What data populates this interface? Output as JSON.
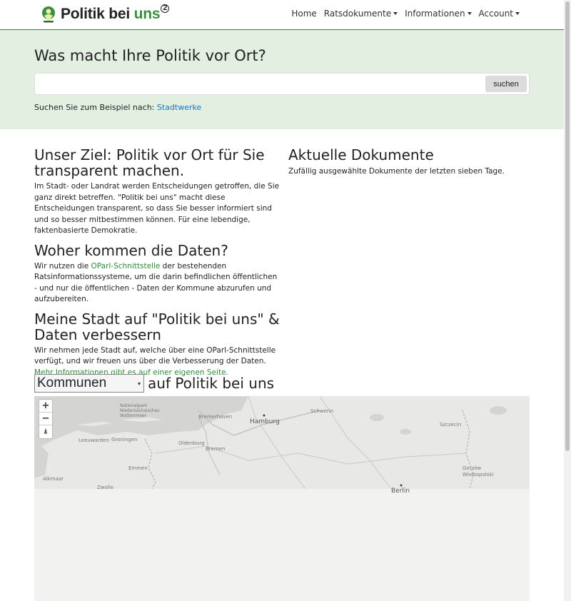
{
  "brand": {
    "name_part1": "Politik bei ",
    "name_part2": "uns",
    "superscript": "2"
  },
  "nav": {
    "items": [
      {
        "label": "Home",
        "dropdown": false
      },
      {
        "label": "Ratsdokumente",
        "dropdown": true
      },
      {
        "label": "Informationen",
        "dropdown": true
      },
      {
        "label": "Account",
        "dropdown": true
      }
    ]
  },
  "hero": {
    "title": "Was macht Ihre Politik vor Ort?",
    "search_value": "",
    "search_button": "suchen",
    "hint_prefix": "Suchen Sie zum Beispiel nach: ",
    "hint_link": "Stadtwerke"
  },
  "left": {
    "goal_title": "Unser Ziel: Politik vor Ort für Sie transparent machen.",
    "goal_text": "Im Stadt- oder Landrat werden Entscheidungen getroffen, die Sie ganz direkt betreffen. \"Politik bei uns\" macht diese Entscheidungen transparent, so dass Sie besser informiert sind und so besser mitbestimmen können. Für eine lebendige, faktenbasierte Demokratie.",
    "data_title": "Woher kommen die Daten?",
    "data_text_prefix": "Wir nutzen die ",
    "data_link": "OParl-Schnittstelle",
    "data_text_suffix": " der bestehenden Ratsinformationssysteme, um die darin befindlichen öffentlichen - und nur die öffentlichen - Daten der Kommune abzurufen und aufzubereiten.",
    "city_title": "Meine Stadt auf \"Politik bei uns\" & Daten verbessern",
    "city_text": "Wir nehmen jede Stadt auf, welche über eine OParl-Schnittstelle verfügt, und wir freuen uns über die Verbesserung der Daten. ",
    "city_link": "Mehr Informationen gibt es auf einer eigenen Seite."
  },
  "right": {
    "docs_title": "Aktuelle Dokumente",
    "docs_text": "Zufällig ausgewählte Dokumente der letzten sieben Tage."
  },
  "kommunen": {
    "selected": "Kommunen",
    "suffix": "auf Politik bei uns"
  },
  "map": {
    "zoom_in": "+",
    "zoom_out": "−",
    "reset": "⍋",
    "labels": {
      "hamburg": "Hamburg",
      "berlin": "Berlin",
      "bremen": "Bremen",
      "bremerhaven": "Bremerhaven",
      "schwerin": "Schwerin",
      "szczecin": "Szczecin",
      "groningen": "Groningen",
      "leeuwarden": "Leeuwarden",
      "oldenburg": "Oldenburg",
      "emmen": "Emmen",
      "zwolle": "Zwolle",
      "alkmaar": "Alkmaar",
      "gorzow": "Gorzów Wielkopolski",
      "nationalpark": "Nationalpark Niedersächsisches Wattenmeer"
    }
  }
}
